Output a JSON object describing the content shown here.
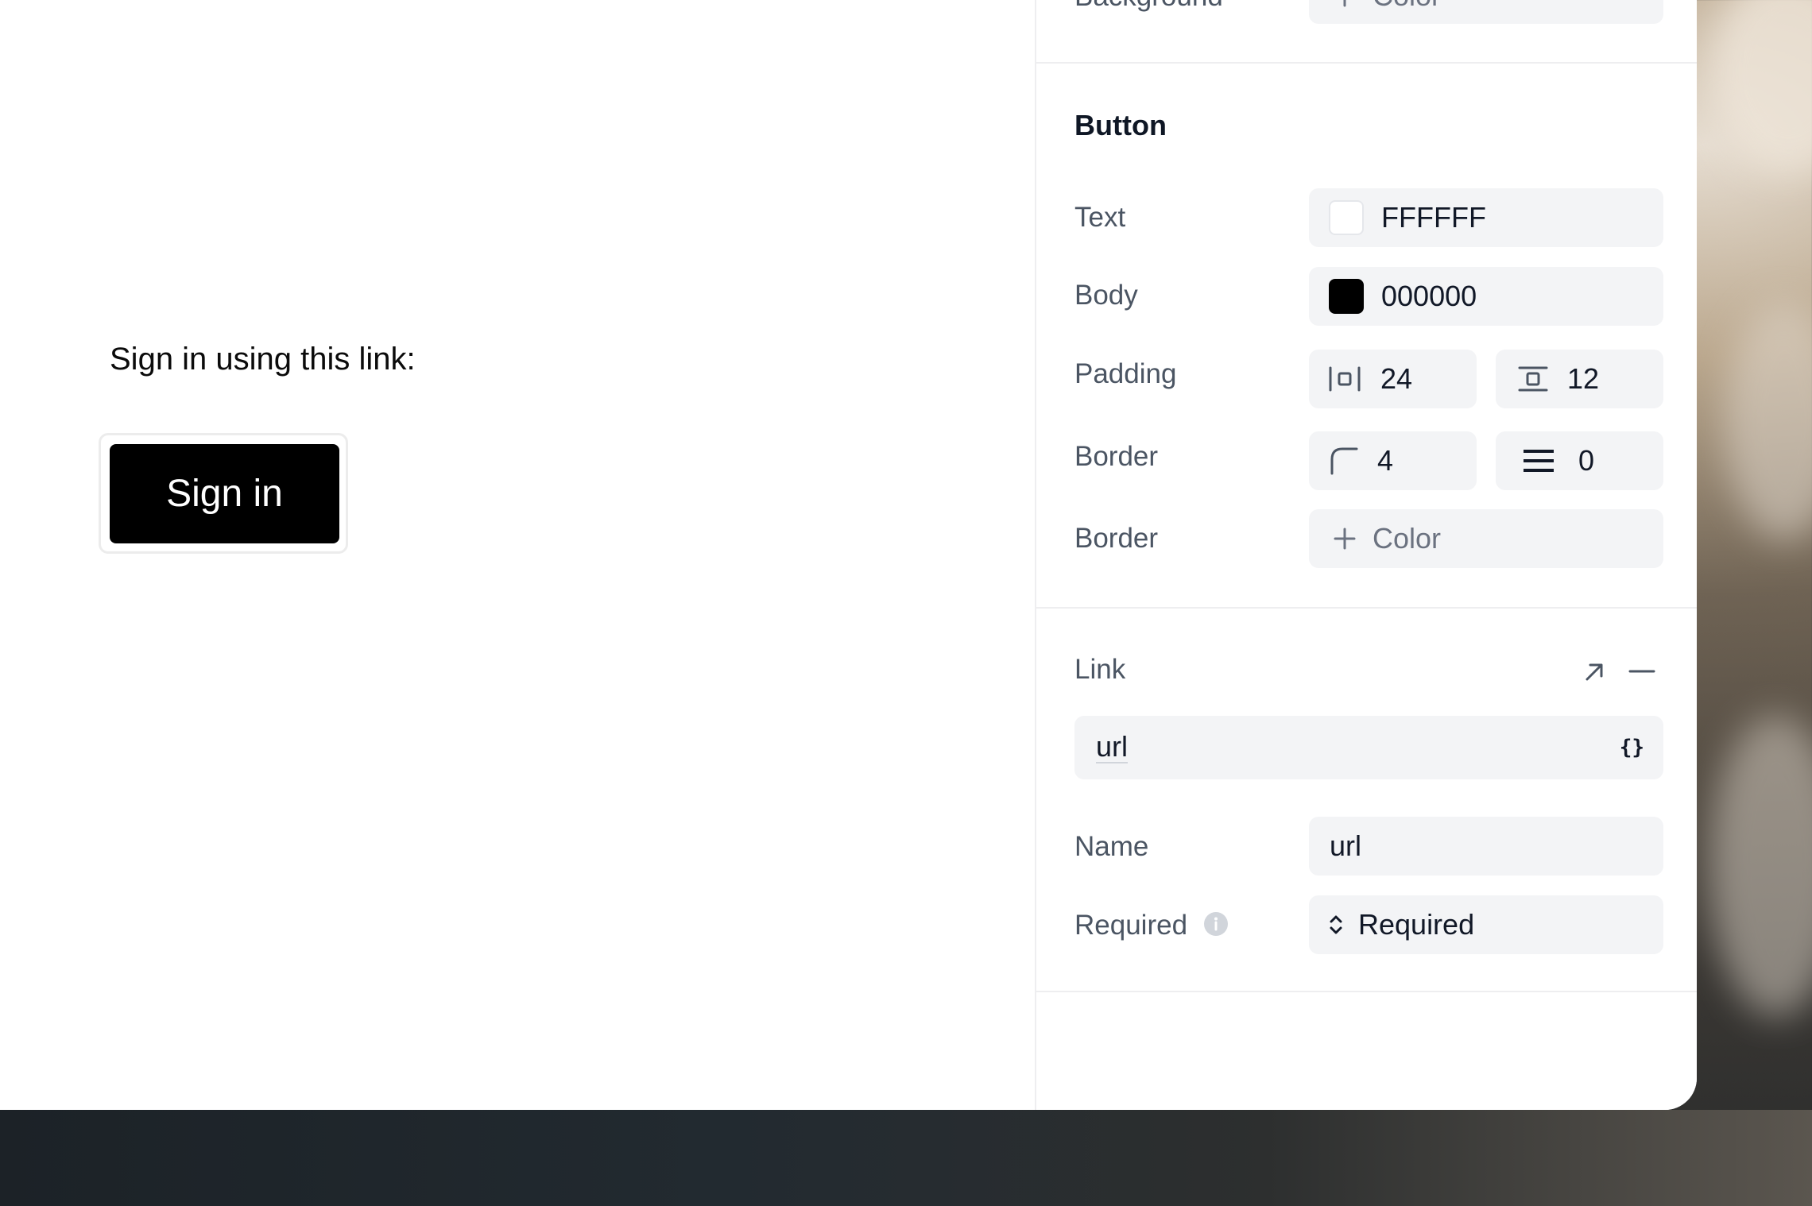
{
  "preview": {
    "intro_text": "Sign in using this link:",
    "button_label": "Sign in"
  },
  "panel": {
    "top_partial": {
      "label": "Background",
      "value": "Color"
    },
    "button_section": {
      "title": "Button",
      "text_color": {
        "label": "Text",
        "value": "FFFFFF",
        "swatch": "#FFFFFF"
      },
      "body_color": {
        "label": "Body",
        "value": "000000",
        "swatch": "#000000"
      },
      "padding": {
        "label": "Padding",
        "horizontal": "24",
        "vertical": "12"
      },
      "border_radius_width": {
        "label": "Border",
        "radius": "4",
        "width": "0"
      },
      "border_color": {
        "label": "Border",
        "value": "Color"
      }
    },
    "link_section": {
      "title": "Link",
      "url_value": "url",
      "variable_icon": "{}",
      "name": {
        "label": "Name",
        "value": "url"
      },
      "required": {
        "label": "Required",
        "value": "Required"
      }
    }
  },
  "icons": {
    "external": "arrow-up-right-icon",
    "remove": "minus-icon",
    "variable": "braces-icon",
    "info": "info-icon",
    "select": "chevron-up-down-icon"
  }
}
